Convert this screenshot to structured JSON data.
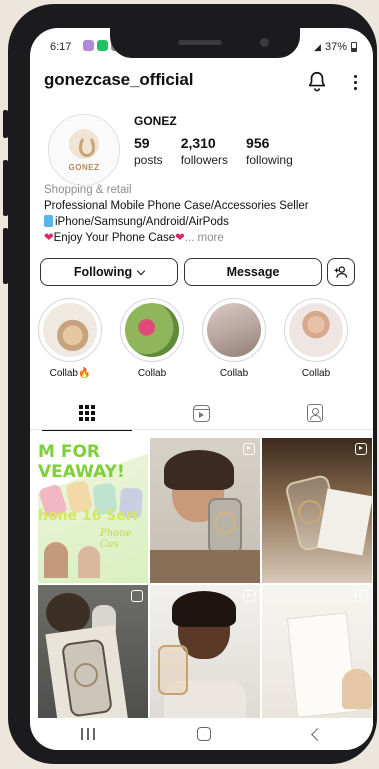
{
  "status_bar": {
    "time": "6:17",
    "battery": "37%"
  },
  "header": {
    "username": "gonezcase_official"
  },
  "profile": {
    "avatar_text": "GONEZ",
    "name": "GONEZ",
    "stats": [
      {
        "value": "59",
        "label": "posts"
      },
      {
        "value": "2,310",
        "label": "followers"
      },
      {
        "value": "956",
        "label": "following"
      }
    ]
  },
  "bio": {
    "category": "Shopping & retail",
    "line1": "Professional Mobile Phone Case/Accessories Seller",
    "line2": "iPhone/Samsung/Android/AirPods",
    "line3": "Enjoy Your Phone Case",
    "more": "... more"
  },
  "actions": {
    "following_label": "Following",
    "message_label": "Message"
  },
  "highlights": [
    {
      "label": "Collab🔥"
    },
    {
      "label": "Collab"
    },
    {
      "label": "Collab"
    },
    {
      "label": "Collab"
    }
  ],
  "tabs": [
    "grid-icon",
    "reels-icon",
    "tagged-icon"
  ],
  "posts": {
    "p1_text1": "M FOR",
    "p1_text2": "VEAWAY!",
    "p1_text3": "hone 16 Seri",
    "p1_text4": "Phone Cas"
  },
  "colors": {
    "text": "#111111",
    "muted": "#8e8e8e",
    "accent_green": "#7ecf3a",
    "heart": "#e0245e"
  }
}
